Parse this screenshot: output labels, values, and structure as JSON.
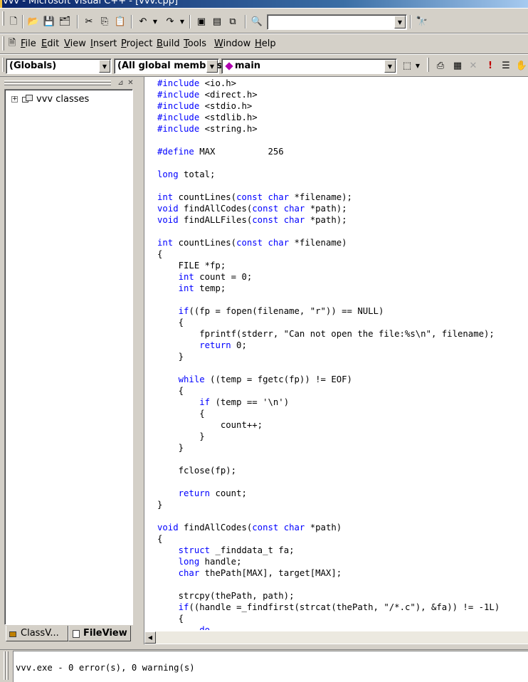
{
  "window": {
    "title": "vvv - Microsoft Visual C++ - [vvv.cpp]"
  },
  "toolbar": {
    "find_combo_value": "",
    "buttons": [
      {
        "name": "new-text-file-button",
        "icon": "new-file-icon",
        "glyph": "🗋"
      },
      {
        "name": "open-button",
        "icon": "open-folder-icon",
        "glyph": "📂"
      },
      {
        "name": "save-button",
        "icon": "save-icon",
        "glyph": "💾"
      },
      {
        "name": "save-all-button",
        "icon": "save-all-icon",
        "glyph": "🗂"
      },
      {
        "name": "cut-button",
        "icon": "cut-icon",
        "glyph": "✂"
      },
      {
        "name": "copy-button",
        "icon": "copy-icon",
        "glyph": "⎘"
      },
      {
        "name": "paste-button",
        "icon": "paste-icon",
        "glyph": "📋"
      },
      {
        "name": "undo-button",
        "icon": "undo-icon",
        "glyph": "↶"
      },
      {
        "name": "redo-button",
        "icon": "redo-icon",
        "glyph": "↷"
      },
      {
        "name": "workspace-toggle-button",
        "icon": "workspace-icon",
        "glyph": "▣"
      },
      {
        "name": "output-toggle-button",
        "icon": "output-window-icon",
        "glyph": "▤"
      },
      {
        "name": "window-list-button",
        "icon": "windows-icon",
        "glyph": "⧉"
      },
      {
        "name": "find-in-files-button",
        "icon": "find-in-files-icon",
        "glyph": "🔍"
      },
      {
        "name": "find-button",
        "icon": "binoculars-icon",
        "glyph": "🔭"
      }
    ]
  },
  "menu": {
    "items": [
      {
        "label": "File",
        "accel": "F"
      },
      {
        "label": "Edit",
        "accel": "E"
      },
      {
        "label": "View",
        "accel": "V"
      },
      {
        "label": "Insert",
        "accel": "I"
      },
      {
        "label": "Project",
        "accel": "P"
      },
      {
        "label": "Build",
        "accel": "B"
      },
      {
        "label": "Tools",
        "accel": "T"
      },
      {
        "label": "Window",
        "accel": "W"
      },
      {
        "label": "Help",
        "accel": "H"
      }
    ]
  },
  "wizardbar": {
    "class_combo": "(Globals)",
    "filter_combo": "(All global members",
    "members_combo": "main",
    "build_buttons": [
      {
        "name": "compile-button",
        "icon": "compile-icon",
        "glyph": "⎙"
      },
      {
        "name": "build-button",
        "icon": "build-icon",
        "glyph": "▦"
      },
      {
        "name": "stop-build-button",
        "icon": "stop-build-icon",
        "glyph": "✕"
      },
      {
        "name": "execute-button",
        "icon": "exclamation-icon",
        "glyph": "!"
      },
      {
        "name": "insert-breakpoint-button",
        "icon": "breakpoint-list-icon",
        "glyph": "☰"
      },
      {
        "name": "go-button",
        "icon": "hand-icon",
        "glyph": "✋"
      }
    ]
  },
  "workspace": {
    "tree_root": "vvv classes",
    "tabs": [
      {
        "label": "ClassV...",
        "active": false
      },
      {
        "label": "FileView",
        "active": true
      }
    ]
  },
  "editor": {
    "lines": [
      [
        {
          "t": "#include",
          "k": 1
        },
        {
          "t": " <io.h>"
        }
      ],
      [
        {
          "t": "#include",
          "k": 1
        },
        {
          "t": " <direct.h>"
        }
      ],
      [
        {
          "t": "#include",
          "k": 1
        },
        {
          "t": " <stdio.h>"
        }
      ],
      [
        {
          "t": "#include",
          "k": 1
        },
        {
          "t": " <stdlib.h>"
        }
      ],
      [
        {
          "t": "#include",
          "k": 1
        },
        {
          "t": " <string.h>"
        }
      ],
      [],
      [
        {
          "t": "#define",
          "k": 1
        },
        {
          "t": " MAX          256"
        }
      ],
      [],
      [
        {
          "t": "long",
          "k": 1
        },
        {
          "t": " total;"
        }
      ],
      [],
      [
        {
          "t": "int",
          "k": 1
        },
        {
          "t": " countLines("
        },
        {
          "t": "const",
          "k": 1
        },
        {
          "t": " "
        },
        {
          "t": "char",
          "k": 1
        },
        {
          "t": " *filename);"
        }
      ],
      [
        {
          "t": "void",
          "k": 1
        },
        {
          "t": " findAllCodes("
        },
        {
          "t": "const",
          "k": 1
        },
        {
          "t": " "
        },
        {
          "t": "char",
          "k": 1
        },
        {
          "t": " *path);"
        }
      ],
      [
        {
          "t": "void",
          "k": 1
        },
        {
          "t": " findALLFiles("
        },
        {
          "t": "const",
          "k": 1
        },
        {
          "t": " "
        },
        {
          "t": "char",
          "k": 1
        },
        {
          "t": " *path);"
        }
      ],
      [],
      [
        {
          "t": "int",
          "k": 1
        },
        {
          "t": " countLines("
        },
        {
          "t": "const",
          "k": 1
        },
        {
          "t": " "
        },
        {
          "t": "char",
          "k": 1
        },
        {
          "t": " *filename)"
        }
      ],
      [
        {
          "t": "{"
        }
      ],
      [
        {
          "t": "    FILE *fp;"
        }
      ],
      [
        {
          "t": "    "
        },
        {
          "t": "int",
          "k": 1
        },
        {
          "t": " count = 0;"
        }
      ],
      [
        {
          "t": "    "
        },
        {
          "t": "int",
          "k": 1
        },
        {
          "t": " temp;"
        }
      ],
      [],
      [
        {
          "t": "    "
        },
        {
          "t": "if",
          "k": 1
        },
        {
          "t": "((fp = fopen(filename, \"r\")) == NULL)"
        }
      ],
      [
        {
          "t": "    {"
        }
      ],
      [
        {
          "t": "        fprintf(stderr, \"Can not open the file:%s\\n\", filename);"
        }
      ],
      [
        {
          "t": "        "
        },
        {
          "t": "return",
          "k": 1
        },
        {
          "t": " 0;"
        }
      ],
      [
        {
          "t": "    }"
        }
      ],
      [],
      [
        {
          "t": "    "
        },
        {
          "t": "while",
          "k": 1
        },
        {
          "t": " ((temp = fgetc(fp)) != EOF)"
        }
      ],
      [
        {
          "t": "    {"
        }
      ],
      [
        {
          "t": "        "
        },
        {
          "t": "if",
          "k": 1
        },
        {
          "t": " (temp == '\\n')"
        }
      ],
      [
        {
          "t": "        {"
        }
      ],
      [
        {
          "t": "            count++;"
        }
      ],
      [
        {
          "t": "        }"
        }
      ],
      [
        {
          "t": "    }"
        }
      ],
      [],
      [
        {
          "t": "    fclose(fp);"
        }
      ],
      [],
      [
        {
          "t": "    "
        },
        {
          "t": "return",
          "k": 1
        },
        {
          "t": " count;"
        }
      ],
      [
        {
          "t": "}"
        }
      ],
      [],
      [
        {
          "t": "void",
          "k": 1
        },
        {
          "t": " findAllCodes("
        },
        {
          "t": "const",
          "k": 1
        },
        {
          "t": " "
        },
        {
          "t": "char",
          "k": 1
        },
        {
          "t": " *path)"
        }
      ],
      [
        {
          "t": "{"
        }
      ],
      [
        {
          "t": "    "
        },
        {
          "t": "struct",
          "k": 1
        },
        {
          "t": " _finddata_t fa;"
        }
      ],
      [
        {
          "t": "    "
        },
        {
          "t": "long",
          "k": 1
        },
        {
          "t": " handle;"
        }
      ],
      [
        {
          "t": "    "
        },
        {
          "t": "char",
          "k": 1
        },
        {
          "t": " thePath[MAX], target[MAX];"
        }
      ],
      [],
      [
        {
          "t": "    strcpy(thePath, path);"
        }
      ],
      [
        {
          "t": "    "
        },
        {
          "t": "if",
          "k": 1
        },
        {
          "t": "((handle =_findfirst(strcat(thePath, \"/*.c\"), &fa)) != -1L)"
        }
      ],
      [
        {
          "t": "    {"
        }
      ],
      [
        {
          "t": "        "
        },
        {
          "t": "do",
          "k": 1
        }
      ]
    ]
  },
  "output": {
    "text": "vvv.exe - 0 error(s), 0 warning(s)"
  },
  "colors": {
    "keyword": "#0000ff",
    "chrome": "#d4d0c8",
    "titlebar_start": "#0a246a"
  }
}
